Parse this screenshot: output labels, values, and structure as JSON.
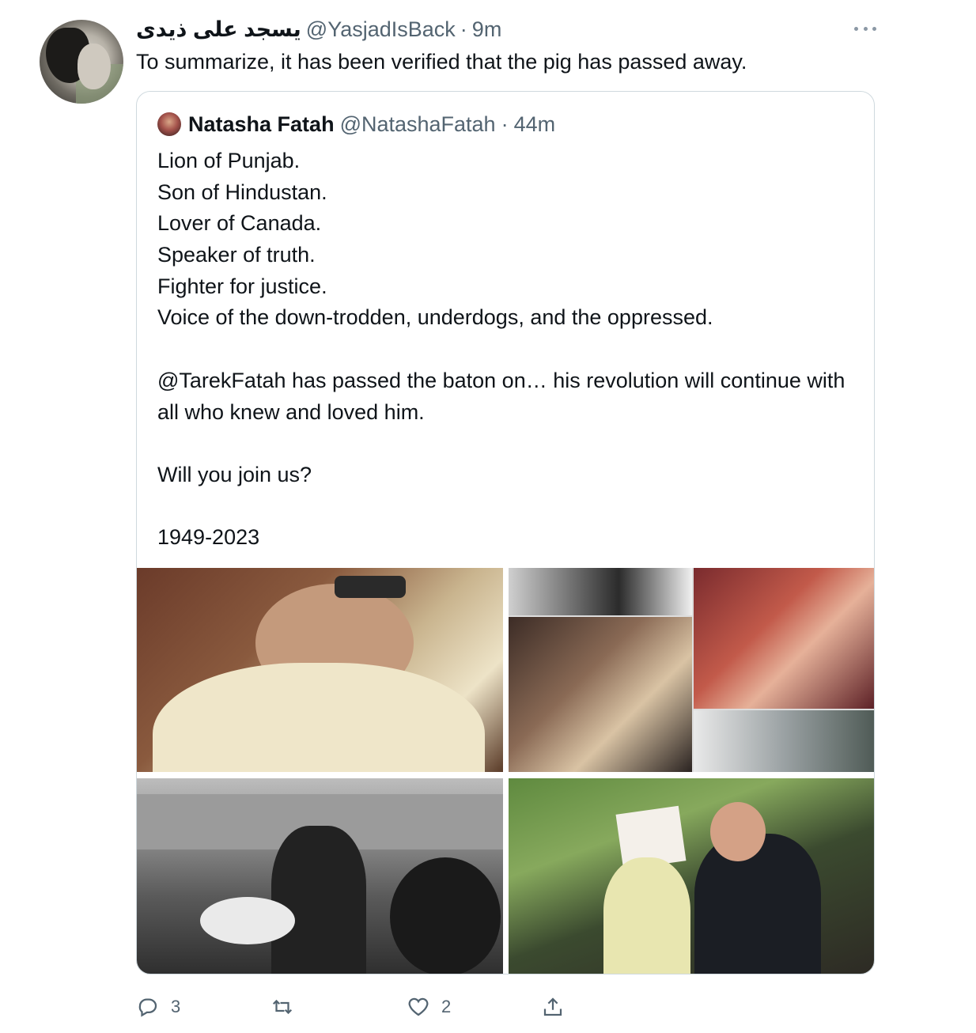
{
  "tweet": {
    "author_name": "يسجد علی ذیدی",
    "handle": "@YasjadIsBack",
    "separator": "·",
    "time": "9m",
    "text": "To summarize, it has been verified that the pig has passed away."
  },
  "quoted": {
    "author_name": "Natasha Fatah",
    "handle": "@NatashaFatah",
    "separator": "·",
    "time": "44m",
    "lines": [
      "Lion of Punjab.",
      "Son of Hindustan.",
      "Lover of Canada.",
      "Speaker of truth.",
      "Fighter for justice.",
      "Voice of the down-trodden, underdogs, and the oppressed."
    ],
    "paragraph_2": "@TarekFatah has passed the baton on… his revolution will continue with all who knew and loved him.",
    "paragraph_3": "Will you join us?",
    "paragraph_4": "1949-2023"
  },
  "actions": {
    "reply_count": "3",
    "retweet_count": "",
    "like_count": "2",
    "share_count": ""
  },
  "icons": {
    "more": "more-dots-icon",
    "reply": "reply-bubble-icon",
    "retweet": "retweet-arrows-icon",
    "like": "heart-icon",
    "share": "share-upload-icon"
  },
  "colors": {
    "text_primary": "#0f1419",
    "text_secondary": "#536471",
    "border": "#cfd9de"
  }
}
